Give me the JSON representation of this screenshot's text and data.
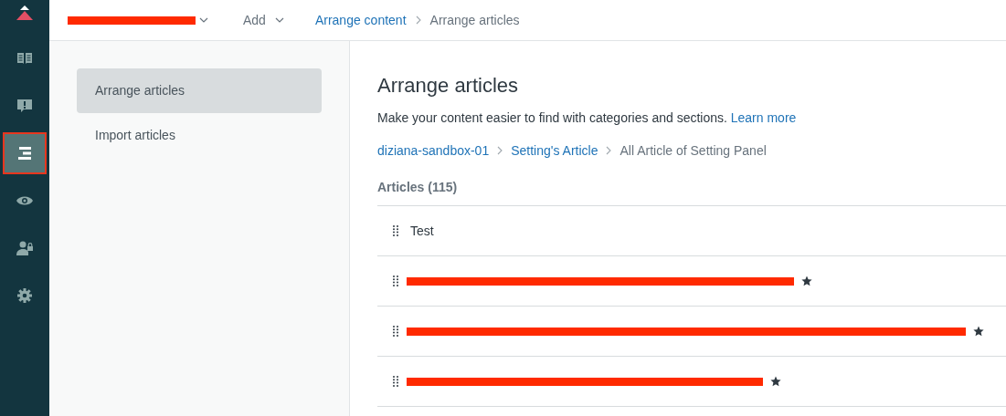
{
  "nav": [
    {
      "selected": false
    },
    {
      "selected": false
    },
    {
      "selected": true
    },
    {
      "selected": false
    },
    {
      "selected": false
    },
    {
      "selected": false
    }
  ],
  "topbar": {
    "brand_redacted": true,
    "add": "Add",
    "breadcrumb": [
      {
        "label": "Arrange content",
        "link": true
      },
      {
        "label": "Arrange articles",
        "link": false
      }
    ]
  },
  "side_menu": [
    {
      "label": "Arrange articles",
      "selected": true
    },
    {
      "label": "Import articles",
      "selected": false
    }
  ],
  "main": {
    "title": "Arrange articles",
    "description": "Make your content easier to find with categories and sections.",
    "learn_more": "Learn more",
    "breadcrumb": [
      {
        "label": "diziana-sandbox-01",
        "link": true
      },
      {
        "label": "Setting's Article",
        "link": true
      },
      {
        "label": "All Article of Setting Panel",
        "link": false
      }
    ],
    "count": "Articles (115)",
    "articles": [
      {
        "kind": "text",
        "title": "Test",
        "promoted": false
      },
      {
        "kind": "redacted",
        "promoted": true
      },
      {
        "kind": "redacted",
        "promoted": true
      },
      {
        "kind": "redacted",
        "promoted": true
      }
    ]
  }
}
